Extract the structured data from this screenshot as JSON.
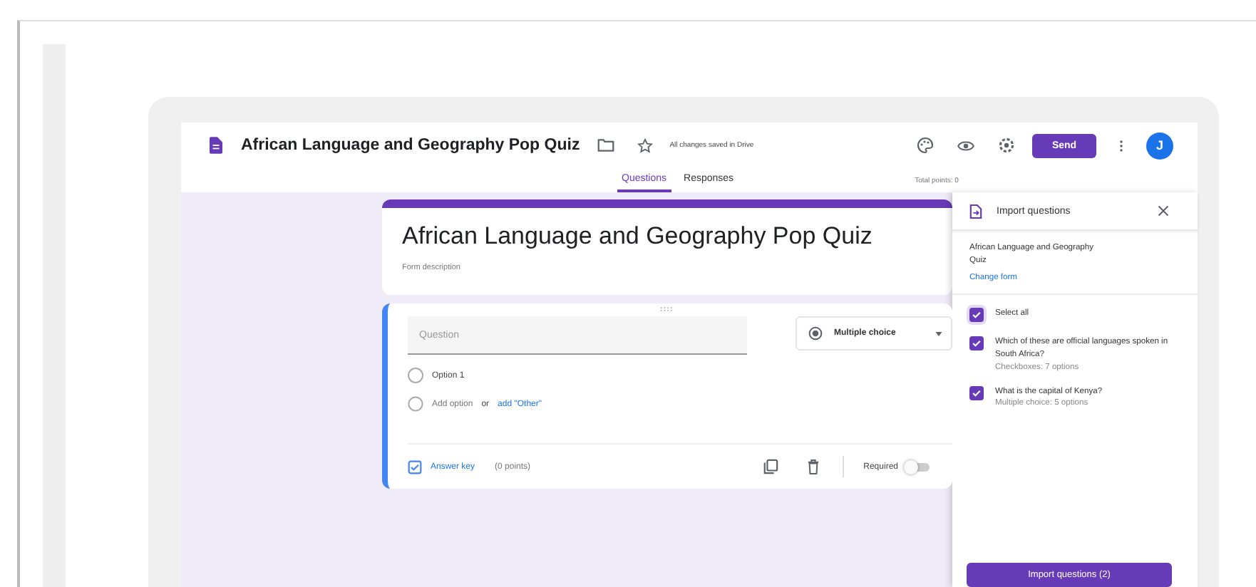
{
  "header": {
    "title": "African Language and Geography Pop Quiz",
    "save_status": "All changes saved in Drive",
    "send_button": "Send",
    "avatar": "J"
  },
  "tabs": [
    {
      "label": "Questions",
      "selected": true
    },
    {
      "label": "Responses",
      "selected": false
    }
  ],
  "total_points": "Total points: 0",
  "form": {
    "title": "African Language and Geography Pop Quiz",
    "description": "Form description"
  },
  "question": {
    "placeholder": "Question",
    "type": "Multiple choice",
    "options": [
      {
        "label": "Option 1",
        "selected": false
      }
    ],
    "add_option": "Add option",
    "or": "or",
    "add_other": "add \"Other\"",
    "answer_key": "Answer key",
    "points": "(0 points)",
    "required_label": "Required",
    "required": false
  },
  "import_panel": {
    "title": "Import questions",
    "form_name": "African Language and Geography Quiz",
    "change_form": "Change form",
    "select_all": {
      "label": "Select all",
      "checked": true
    },
    "questions": [
      {
        "text": "Which of these are official languages spoken in South Africa?",
        "detail": "Checkboxes: 7 options",
        "checked": true
      },
      {
        "text": "What is the capital of Kenya?",
        "detail": "Multiple choice: 5 options",
        "checked": true
      }
    ],
    "import_button": "Import questions (2)"
  }
}
